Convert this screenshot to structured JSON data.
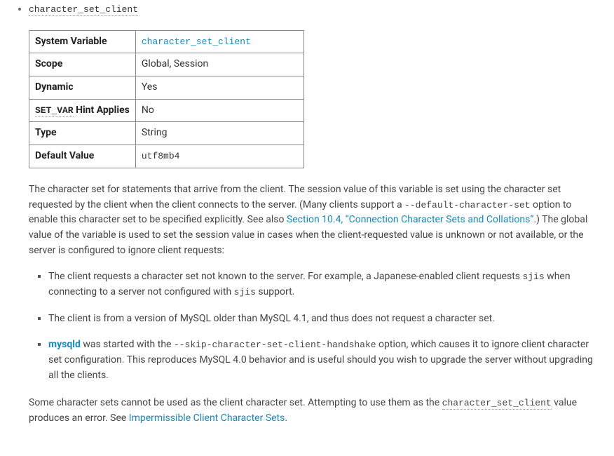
{
  "heading_name": "character_set_client",
  "table": {
    "rows": [
      {
        "label": "System Variable",
        "value": "character_set_client",
        "value_mono": true,
        "value_link": true
      },
      {
        "label": "Scope",
        "value": "Global, Session",
        "value_mono": false,
        "value_link": false
      },
      {
        "label": "Dynamic",
        "value": "Yes",
        "value_mono": false,
        "value_link": false
      },
      {
        "label_prefix_mono": "SET_VAR",
        "label_suffix": " Hint Applies",
        "value": "No",
        "value_mono": false,
        "value_link": false
      },
      {
        "label": "Type",
        "value": "String",
        "value_mono": false,
        "value_link": false
      },
      {
        "label": "Default Value",
        "value": "utf8mb4",
        "value_mono": true,
        "value_link": false
      }
    ]
  },
  "para1": {
    "t1": "The character set for statements that arrive from the client. The session value of this variable is set using the character set requested by the client when the client connects to the server. (Many clients support a ",
    "code1": "--default-character-set",
    "t2": " option to enable this character set to be specified explicitly. See also ",
    "link_text": "Section 10.4, “Connection Character Sets and Collations”",
    "t3": ".) The global value of the variable is used to set the session value in cases when the client-requested value is unknown or not available, or the server is configured to ignore client requests:"
  },
  "bullets": [
    {
      "t1": "The client requests a character set not known to the server. For example, a Japanese-enabled client requests ",
      "code1": "sjis",
      "t2": " when connecting to a server not configured with ",
      "code2": "sjis",
      "t3": " support."
    },
    {
      "t1": "The client is from a version of MySQL older than MySQL 4.1, and thus does not request a character set."
    },
    {
      "link_text": "mysqld",
      "t1": " was started with the ",
      "code1": "--skip-character-set-client-handshake",
      "t2": " option, which causes it to ignore client character set configuration. This reproduces MySQL 4.0 behavior and is useful should you wish to upgrade the server without upgrading all the clients."
    }
  ],
  "para2": {
    "t1": "Some character sets cannot be used as the client character set. Attempting to use them as the ",
    "code1": "character_set_client",
    "t2": " value produces an error. See ",
    "link_text": "Impermissible Client Character Sets",
    "t3": "."
  }
}
